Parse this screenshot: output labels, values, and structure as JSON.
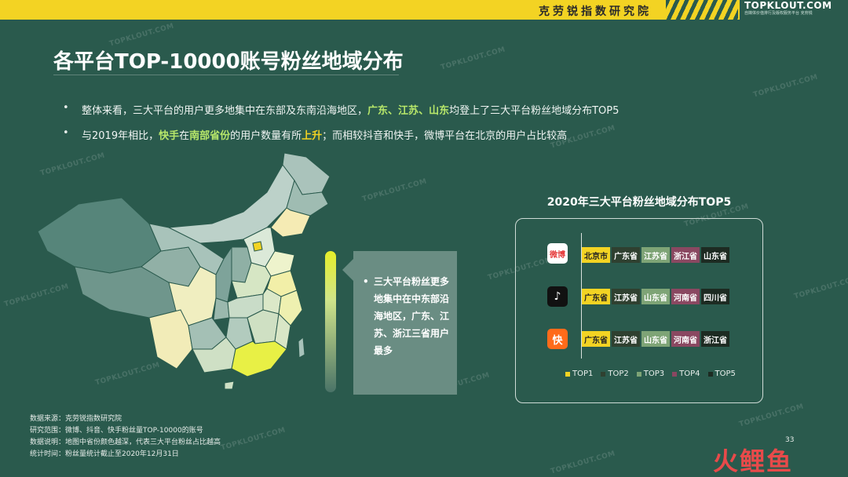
{
  "header": {
    "org_name": "克劳锐指数研究院",
    "brand_name": "TOPKLOUT.COM",
    "brand_sub": "自媒体价值排行及版权服务平台 克劳锐"
  },
  "title": "各平台TOP-10000账号粉丝地域分布",
  "bullets": [
    {
      "p1": "整体来看，三大平台的用户更多地集中在东部及东南沿海地区，",
      "h1": "广东",
      "s1": "、",
      "h2": "江苏",
      "s2": "、",
      "h3": "山东",
      "p2": "均登上了三大平台粉丝地域分布TOP5"
    },
    {
      "p1": "与2019年相比，",
      "h1": "快手",
      "p2": "在",
      "h2": "南部省份",
      "p3": "的用户数量有所",
      "h3": "上升",
      "p4": "；而相较抖音和快手，微博平台在北京的用户占比较高"
    }
  ],
  "callout": {
    "text": "三大平台粉丝更多地集中在中东部沿海地区，广东、江苏、浙江三省用户最多"
  },
  "panel": {
    "title": "2020年三大平台粉丝地域分布TOP5",
    "platforms": [
      {
        "icon": "weibo-icon",
        "icon_text": "微博",
        "cells": [
          "北京市",
          "广东省",
          "江苏省",
          "浙江省",
          "山东省"
        ]
      },
      {
        "icon": "douyin-icon",
        "icon_text": "♪",
        "cells": [
          "广东省",
          "江苏省",
          "山东省",
          "河南省",
          "四川省"
        ]
      },
      {
        "icon": "kuaishou-icon",
        "icon_text": "快",
        "cells": [
          "广东省",
          "江苏省",
          "山东省",
          "河南省",
          "浙江省"
        ]
      }
    ],
    "legend": [
      "TOP1",
      "TOP2",
      "TOP3",
      "TOP4",
      "TOP5"
    ],
    "colors": [
      "#f3d323",
      "#2f4030",
      "#7ea476",
      "#8a4861",
      "#1d2b22"
    ]
  },
  "notes": [
    "数据来源：克劳锐指数研究院",
    "研究范围：微博、抖音、快手粉丝量TOP-10000的账号",
    "数据说明：地图中省份颜色越深，代表三大平台粉丝占比越高",
    "统计时间：粉丝量统计截止至2020年12月31日"
  ],
  "page_number": "33",
  "footer_logo": "火鲤鱼",
  "watermark": "TOPKLOUT.COM"
}
